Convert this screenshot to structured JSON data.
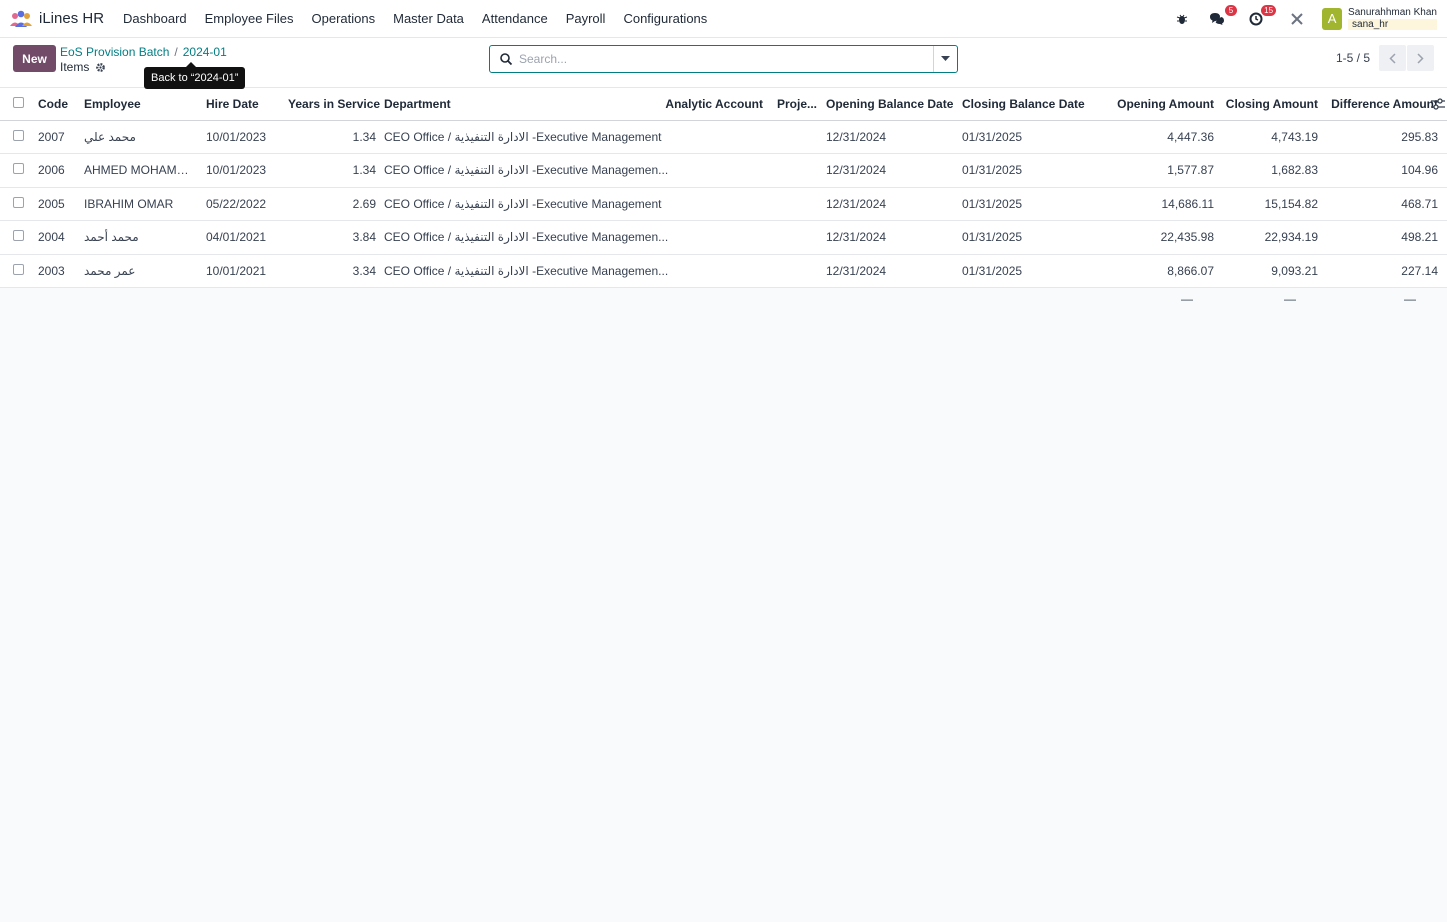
{
  "app": {
    "name": "iLines HR"
  },
  "menu": [
    "Dashboard",
    "Employee Files",
    "Operations",
    "Master Data",
    "Attendance",
    "Payroll",
    "Configurations"
  ],
  "nav_right": {
    "messages_count": "5",
    "activities_count": "15",
    "avatar_letter": "A",
    "user_name": "Sanurahhman Khan",
    "user_db": "sana_hr"
  },
  "control_panel": {
    "new_label": "New",
    "breadcrumb": [
      "EoS Provision Batch",
      "2024-01"
    ],
    "subtitle": "Items",
    "tooltip": "Back to “2024-01”",
    "search_placeholder": "Search...",
    "pager": "1-5 / 5"
  },
  "table": {
    "columns": [
      "Code",
      "Employee",
      "Hire Date",
      "Years in Service",
      "Department",
      "Analytic Account",
      "Proje...",
      "Opening Balance Date",
      "Closing Balance Date",
      "Opening Amount",
      "Closing Amount",
      "Difference Amount"
    ],
    "rows": [
      {
        "code": "2007",
        "employee": "محمد علي",
        "hire_date": "10/01/2023",
        "years": "1.34",
        "department": "CEO Office / الادارة التنفيذية -Executive Management",
        "analytic": "",
        "project": "",
        "opening_date": "12/31/2024",
        "closing_date": "01/31/2025",
        "opening_amount": "4,447.36",
        "closing_amount": "4,743.19",
        "difference": "295.83"
      },
      {
        "code": "2006",
        "employee": "AHMED MOHAMMED",
        "hire_date": "10/01/2023",
        "years": "1.34",
        "department": "CEO Office / الادارة التنفيذية -Executive Managemen...",
        "analytic": "",
        "project": "",
        "opening_date": "12/31/2024",
        "closing_date": "01/31/2025",
        "opening_amount": "1,577.87",
        "closing_amount": "1,682.83",
        "difference": "104.96"
      },
      {
        "code": "2005",
        "employee": "IBRAHIM OMAR",
        "hire_date": "05/22/2022",
        "years": "2.69",
        "department": "CEO Office / الادارة التنفيذية -Executive Management",
        "analytic": "",
        "project": "",
        "opening_date": "12/31/2024",
        "closing_date": "01/31/2025",
        "opening_amount": "14,686.11",
        "closing_amount": "15,154.82",
        "difference": "468.71"
      },
      {
        "code": "2004",
        "employee": "محمد أحمد",
        "hire_date": "04/01/2021",
        "years": "3.84",
        "department": "CEO Office / الادارة التنفيذية -Executive Managemen...",
        "analytic": "",
        "project": "",
        "opening_date": "12/31/2024",
        "closing_date": "01/31/2025",
        "opening_amount": "22,435.98",
        "closing_amount": "22,934.19",
        "difference": "498.21"
      },
      {
        "code": "2003",
        "employee": "عمر محمد",
        "hire_date": "10/01/2021",
        "years": "3.34",
        "department": "CEO Office / الادارة التنفيذية -Executive Managemen...",
        "analytic": "",
        "project": "",
        "opening_date": "12/31/2024",
        "closing_date": "01/31/2025",
        "opening_amount": "8,866.07",
        "closing_amount": "9,093.21",
        "difference": "227.14"
      }
    ],
    "totals": [
      "—",
      "—",
      "—"
    ]
  }
}
